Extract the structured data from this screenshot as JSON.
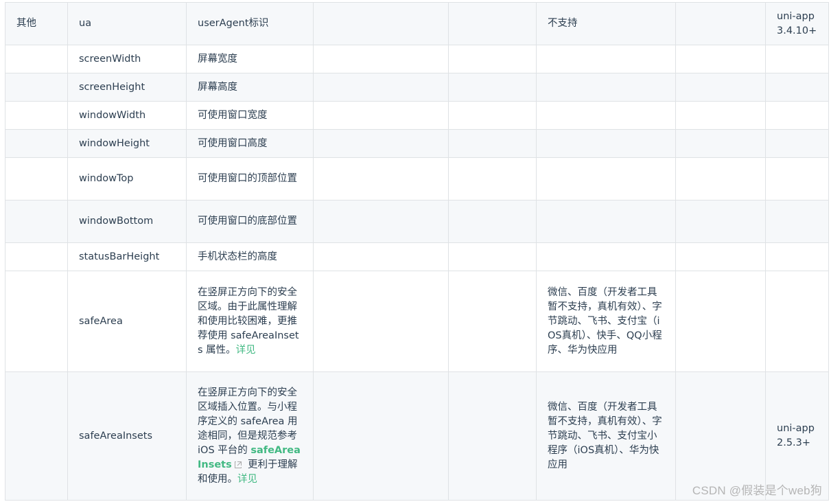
{
  "rows": [
    {
      "cells": [
        "其他",
        "ua",
        "userAgent标识",
        "",
        "",
        "不支持",
        "",
        "uni-app 3.4.10+"
      ]
    },
    {
      "cells": [
        "",
        "screenWidth",
        "屏幕宽度",
        "",
        "",
        "",
        "",
        ""
      ]
    },
    {
      "cells": [
        "",
        "screenHeight",
        "屏幕高度",
        "",
        "",
        "",
        "",
        ""
      ]
    },
    {
      "cells": [
        "",
        "windowWidth",
        "可使用窗口宽度",
        "",
        "",
        "",
        "",
        ""
      ]
    },
    {
      "cells": [
        "",
        "windowHeight",
        "可使用窗口高度",
        "",
        "",
        "",
        "",
        ""
      ]
    },
    {
      "cells": [
        "",
        "windowTop",
        "可使用窗口的顶部位置",
        "",
        "",
        "",
        "",
        ""
      ]
    },
    {
      "cells": [
        "",
        "windowBottom",
        "可使用窗口的底部位置",
        "",
        "",
        "",
        "",
        ""
      ]
    },
    {
      "cells": [
        "",
        "statusBarHeight",
        "手机状态栏的高度",
        "",
        "",
        "",
        "",
        ""
      ]
    },
    {
      "name": "safeArea",
      "description_text": "在竖屏正方向下的安全区域。由于此属性理解和使用比较困难，更推荐使用 safeAreaInsets 属性。",
      "description_link": "详见",
      "unsupported": "微信、百度（开发者工具暂不支持，真机有效）、字节跳动、飞书、支付宝（iOS真机）、快手、QQ小程序、华为快应用",
      "version": ""
    },
    {
      "name": "safeAreaInsets",
      "description_pre": "在竖屏正方向下的安全区域插入位置。与小程序定义的 safeArea 用途相同，但是规范参考 iOS 平台的 ",
      "description_ext_link": "safeAreaInsets",
      "description_post": " 更利于理解和使用。",
      "description_link": "详见",
      "unsupported": "微信、百度（开发者工具暂不支持，真机有效）、字节跳动、飞书、支付宝小程序（iOS真机）、华为快应用",
      "version": "uni-app 2.5.3+"
    }
  ],
  "watermark": "CSDN @假装是个web狗",
  "colors": {
    "border": "#dfe2e5",
    "stripe": "#f6f8fa",
    "text": "#2c3e50",
    "link": "#42b983",
    "watermark": "#b5b5b5"
  },
  "icons": {
    "external_link": "external-link-icon"
  }
}
